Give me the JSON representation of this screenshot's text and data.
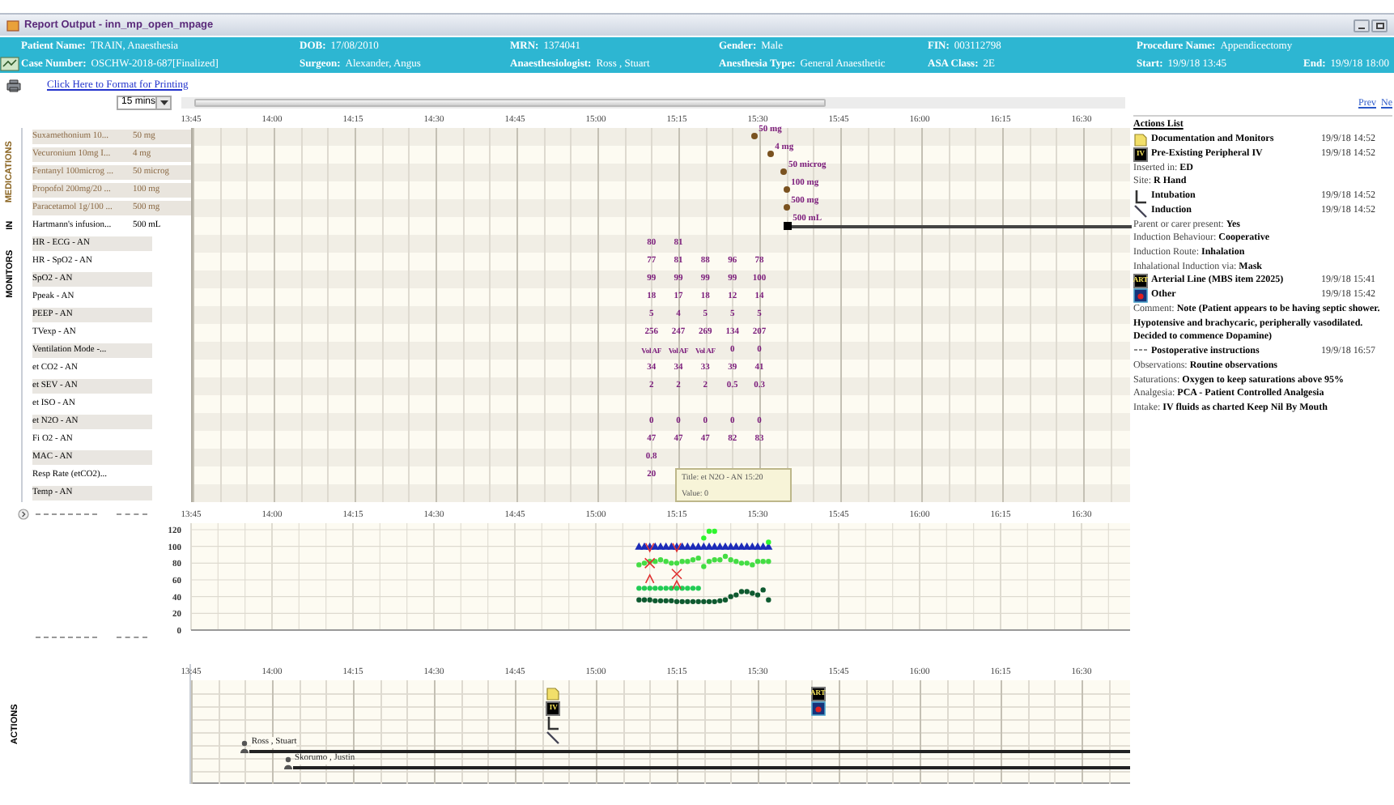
{
  "window": {
    "title": "Report Output - inn_mp_open_mpage"
  },
  "header": {
    "rows": [
      [
        {
          "label": "Patient Name:",
          "value": "TRAIN, Anaesthesia"
        },
        {
          "label": "DOB:",
          "value": "17/08/2010"
        },
        {
          "label": "MRN:",
          "value": "1374041"
        },
        {
          "label": "Gender:",
          "value": "Male"
        },
        {
          "label": "FIN:",
          "value": "003112798"
        },
        {
          "label": "Procedure Name:",
          "value": "Appendicectomy"
        }
      ],
      [
        {
          "label": "Case Number:",
          "value": "OSCHW-2018-687[Finalized]"
        },
        {
          "label": "Surgeon:",
          "value": "Alexander, Angus"
        },
        {
          "label": "Anaesthesiologist:",
          "value": "Ross , Stuart"
        },
        {
          "label": "Anesthesia Type:",
          "value": "General Anaesthetic"
        },
        {
          "label": "ASA Class:",
          "value": "2E"
        },
        {
          "label": "Start:",
          "value": "19/9/18 13:45"
        },
        {
          "label": "End:",
          "value": "19/9/18 18:00"
        }
      ]
    ]
  },
  "print_link": "Click Here to Format for Printing",
  "interval": {
    "value": "15 mins"
  },
  "sections": {
    "medications": "MEDICATIONS",
    "in": "IN",
    "monitors": "MONITORS",
    "actions": "ACTIONS"
  },
  "timeline": {
    "ticks": [
      "13:45",
      "14:00",
      "14:15",
      "14:30",
      "14:45",
      "15:00",
      "15:15",
      "15:30",
      "15:45",
      "16:00",
      "16:15",
      "16:30"
    ]
  },
  "medications": [
    {
      "kind": "bolus",
      "name": "Suxamethonium 10...",
      "dose": "50 mg",
      "chart_dose": "50 mg"
    },
    {
      "kind": "bolus",
      "name": "Vecuronium 10mg I...",
      "dose": "4 mg",
      "chart_dose": "4 mg"
    },
    {
      "kind": "bolus",
      "name": "Fentanyl 100microg ...",
      "dose": "50 microg",
      "chart_dose": "50 microg"
    },
    {
      "kind": "bolus",
      "name": "Propofol 200mg/20 ...",
      "dose": "100 mg",
      "chart_dose": "100 mg"
    },
    {
      "kind": "bolus",
      "name": "Paracetamol 1g/100 ...",
      "dose": "500 mg",
      "chart_dose": "500 mg"
    },
    {
      "kind": "infusion",
      "name": "Hartmann's infusion...",
      "dose": "500 mL",
      "chart_dose": "500 mL"
    }
  ],
  "monitors": [
    {
      "name": "HR - ECG - AN",
      "values": [
        "80",
        "81"
      ]
    },
    {
      "name": "HR - SpO2 - AN",
      "values": [
        "77",
        "81",
        "88",
        "96",
        "78"
      ]
    },
    {
      "name": "SpO2 - AN",
      "values": [
        "99",
        "99",
        "99",
        "99",
        "100"
      ]
    },
    {
      "name": "Ppeak - AN",
      "values": [
        "18",
        "17",
        "18",
        "12",
        "14"
      ]
    },
    {
      "name": "PEEP - AN",
      "values": [
        "5",
        "4",
        "5",
        "5",
        "5"
      ]
    },
    {
      "name": "TVexp - AN",
      "values": [
        "256",
        "247",
        "269",
        "134",
        "207"
      ]
    },
    {
      "name": "Ventilation Mode -...",
      "values": [
        "Vol AF",
        "Vol AF",
        "Vol AF",
        "0",
        "0"
      ]
    },
    {
      "name": "et CO2 - AN",
      "values": [
        "34",
        "34",
        "33",
        "39",
        "41"
      ]
    },
    {
      "name": "et SEV - AN",
      "values": [
        "2",
        "2",
        "2",
        "0.5",
        "0.3"
      ]
    },
    {
      "name": "et ISO - AN"
    },
    {
      "name": "et N2O - AN",
      "values": [
        "0",
        "0",
        "0",
        "0",
        "0"
      ]
    },
    {
      "name": "Fi O2 - AN",
      "values": [
        "47",
        "47",
        "47",
        "82",
        "83"
      ]
    },
    {
      "name": "MAC - AN",
      "values": [
        "0.8"
      ]
    },
    {
      "name": "Resp Rate (etCO2)...",
      "values": [
        "20"
      ]
    },
    {
      "name": "Temp - AN"
    }
  ],
  "tooltip": {
    "title": "Title: et N2O - AN 15:20",
    "value": "Value: 0"
  },
  "vitals": {
    "chart_data": {
      "type": "scatter",
      "categories": [
        "13:45",
        null,
        null,
        null,
        null,
        null,
        null,
        null,
        null,
        null,
        null,
        null,
        null,
        null,
        null,
        "14:00",
        null,
        null,
        null,
        null,
        null,
        null,
        null,
        null,
        null,
        null,
        null,
        null,
        null,
        null,
        "14:15",
        null,
        null,
        null,
        null,
        null,
        null,
        null,
        null,
        null,
        null,
        null,
        null,
        null,
        null,
        "14:30",
        null,
        null,
        null,
        null,
        null,
        null,
        null,
        null,
        null,
        null,
        null,
        null,
        null,
        null,
        "14:45",
        null,
        null,
        null,
        null,
        null,
        null,
        null,
        null,
        null,
        null,
        null,
        null,
        null,
        null,
        "15:00",
        null,
        null,
        null,
        null,
        null,
        null,
        null,
        null,
        null,
        null,
        null,
        null,
        null,
        null,
        "15:15",
        null,
        null,
        null,
        null,
        null,
        null,
        null,
        null,
        null,
        null,
        null,
        null,
        null,
        null,
        "15:30",
        null,
        null,
        null,
        null,
        null,
        null,
        null,
        null,
        null,
        null,
        null,
        null,
        null,
        null,
        "15:45",
        null,
        null,
        null,
        null,
        null,
        null,
        null,
        null,
        null,
        null,
        null,
        null,
        null,
        null,
        "16:00",
        null,
        null,
        null,
        null,
        null,
        null,
        null,
        null,
        null,
        null,
        null,
        null,
        null,
        null,
        "16:15",
        null,
        null,
        null,
        null,
        null,
        null,
        null,
        null,
        null,
        null,
        null,
        null,
        null,
        null,
        "16:30",
        null,
        null,
        null,
        null,
        null,
        null,
        null,
        null,
        null
      ],
      "ylim": [
        0,
        120
      ],
      "yticks": [
        0,
        20,
        40,
        60,
        80,
        100,
        120
      ],
      "grid": true,
      "series": [
        {
          "color": "#1c2bb8",
          "values": [
            null,
            null,
            null,
            null,
            null,
            null,
            null,
            null,
            null,
            null,
            null,
            null,
            null,
            null,
            null,
            null,
            null,
            null,
            null,
            null,
            null,
            null,
            null,
            null,
            null,
            null,
            null,
            null,
            null,
            null,
            null,
            null,
            null,
            null,
            null,
            null,
            null,
            null,
            null,
            null,
            null,
            null,
            null,
            null,
            null,
            null,
            null,
            null,
            null,
            null,
            null,
            null,
            null,
            null,
            null,
            null,
            null,
            null,
            null,
            null,
            null,
            null,
            null,
            null,
            null,
            null,
            null,
            null,
            null,
            null,
            null,
            null,
            null,
            null,
            null,
            null,
            null,
            null,
            null,
            null,
            null,
            null,
            null,
            100,
            100,
            100,
            100,
            100,
            100,
            100,
            100,
            100,
            100,
            100,
            100,
            100,
            100,
            100,
            100,
            100,
            100,
            100,
            100,
            100,
            100,
            100,
            100,
            100,
            null,
            null,
            null,
            null,
            null,
            null,
            null,
            null,
            null,
            null,
            null,
            null,
            null,
            null,
            null,
            null,
            null,
            null,
            null,
            null,
            null,
            null,
            null,
            null,
            null,
            null,
            null,
            null,
            null,
            null,
            null,
            null,
            null,
            null,
            null,
            null,
            null,
            null,
            null,
            null,
            null,
            null,
            null,
            null,
            null,
            null,
            null,
            null,
            null,
            null,
            null,
            null,
            null,
            null,
            null,
            null,
            null,
            null,
            null,
            null,
            null,
            null,
            null,
            null,
            null,
            null,
            null
          ]
        },
        {
          "color": "#2ff52f",
          "values": [
            null,
            null,
            null,
            null,
            null,
            null,
            null,
            null,
            null,
            null,
            null,
            null,
            null,
            null,
            null,
            null,
            null,
            null,
            null,
            null,
            null,
            null,
            null,
            null,
            null,
            null,
            null,
            null,
            null,
            null,
            null,
            null,
            null,
            null,
            null,
            null,
            null,
            null,
            null,
            null,
            null,
            null,
            null,
            null,
            null,
            null,
            null,
            null,
            null,
            null,
            null,
            null,
            null,
            null,
            null,
            null,
            null,
            null,
            null,
            null,
            null,
            null,
            null,
            null,
            null,
            null,
            null,
            null,
            null,
            null,
            null,
            null,
            null,
            null,
            null,
            null,
            null,
            null,
            null,
            null,
            null,
            null,
            null,
            null,
            null,
            null,
            null,
            null,
            null,
            null,
            null,
            null,
            null,
            null,
            null,
            110,
            118,
            118,
            null,
            null,
            null,
            null,
            null,
            null,
            null,
            null,
            null,
            105,
            null,
            null,
            null,
            null,
            null,
            null,
            null,
            null,
            null,
            null,
            null,
            null,
            null,
            null,
            null,
            null,
            null,
            null,
            null,
            null,
            null,
            null,
            null,
            null,
            null,
            null,
            null,
            null,
            null,
            null,
            null,
            null,
            null,
            null,
            null,
            null,
            null,
            null,
            null,
            null,
            null,
            null,
            null,
            null,
            null,
            null,
            null,
            null,
            null,
            null,
            null,
            null,
            null,
            null,
            null,
            null,
            null,
            null,
            null,
            null,
            null,
            null,
            null,
            null,
            null,
            null,
            null
          ]
        },
        {
          "color": "#44dd44",
          "values": [
            null,
            null,
            null,
            null,
            null,
            null,
            null,
            null,
            null,
            null,
            null,
            null,
            null,
            null,
            null,
            null,
            null,
            null,
            null,
            null,
            null,
            null,
            null,
            null,
            null,
            null,
            null,
            null,
            null,
            null,
            null,
            null,
            null,
            null,
            null,
            null,
            null,
            null,
            null,
            null,
            null,
            null,
            null,
            null,
            null,
            null,
            null,
            null,
            null,
            null,
            null,
            null,
            null,
            null,
            null,
            null,
            null,
            null,
            null,
            null,
            null,
            null,
            null,
            null,
            null,
            null,
            null,
            null,
            null,
            null,
            null,
            null,
            null,
            null,
            null,
            null,
            null,
            null,
            null,
            null,
            null,
            null,
            null,
            78,
            80,
            82,
            82,
            84,
            82,
            80,
            80,
            82,
            82,
            84,
            86,
            76,
            82,
            84,
            84,
            88,
            84,
            82,
            80,
            80,
            78,
            82,
            82,
            82,
            null,
            null,
            null,
            null,
            null,
            null,
            null,
            null,
            null,
            null,
            null,
            null,
            null,
            null,
            null,
            null,
            null,
            null,
            null,
            null,
            null,
            null,
            null,
            null,
            null,
            null,
            null,
            null,
            null,
            null,
            null,
            null,
            null,
            null,
            null,
            null,
            null,
            null,
            null,
            null,
            null,
            null,
            null,
            null,
            null,
            null,
            null,
            null,
            null,
            null,
            null,
            null,
            null,
            null,
            null,
            null,
            null,
            null,
            null,
            null,
            null,
            null,
            null,
            null,
            null,
            null,
            null
          ]
        },
        {
          "color": "#22cc55",
          "values": [
            null,
            null,
            null,
            null,
            null,
            null,
            null,
            null,
            null,
            null,
            null,
            null,
            null,
            null,
            null,
            null,
            null,
            null,
            null,
            null,
            null,
            null,
            null,
            null,
            null,
            null,
            null,
            null,
            null,
            null,
            null,
            null,
            null,
            null,
            null,
            null,
            null,
            null,
            null,
            null,
            null,
            null,
            null,
            null,
            null,
            null,
            null,
            null,
            null,
            null,
            null,
            null,
            null,
            null,
            null,
            null,
            null,
            null,
            null,
            null,
            null,
            null,
            null,
            null,
            null,
            null,
            null,
            null,
            null,
            null,
            null,
            null,
            null,
            null,
            null,
            null,
            null,
            null,
            null,
            null,
            null,
            null,
            null,
            50,
            50,
            50,
            50,
            50,
            50,
            50,
            50,
            50,
            50,
            50,
            50,
            null,
            null,
            null,
            null,
            null,
            null,
            null,
            null,
            null,
            null,
            null,
            null,
            null,
            null,
            null,
            null,
            null,
            null,
            null,
            null,
            null,
            null,
            null,
            null,
            null,
            null,
            null,
            null,
            null,
            null,
            null,
            null,
            null,
            null,
            null,
            null,
            null,
            null,
            null,
            null,
            null,
            null,
            null,
            null,
            null,
            null,
            null,
            null,
            null,
            null,
            null,
            null,
            null,
            null,
            null,
            null,
            null,
            null,
            null,
            null,
            null,
            null,
            null,
            null,
            null,
            null,
            null,
            null,
            null,
            null,
            null,
            null,
            null,
            null,
            null,
            null,
            null,
            null,
            null,
            null
          ]
        },
        {
          "color": "#0f5a30",
          "values": [
            null,
            null,
            null,
            null,
            null,
            null,
            null,
            null,
            null,
            null,
            null,
            null,
            null,
            null,
            null,
            null,
            null,
            null,
            null,
            null,
            null,
            null,
            null,
            null,
            null,
            null,
            null,
            null,
            null,
            null,
            null,
            null,
            null,
            null,
            null,
            null,
            null,
            null,
            null,
            null,
            null,
            null,
            null,
            null,
            null,
            null,
            null,
            null,
            null,
            null,
            null,
            null,
            null,
            null,
            null,
            null,
            null,
            null,
            null,
            null,
            null,
            null,
            null,
            null,
            null,
            null,
            null,
            null,
            null,
            null,
            null,
            null,
            null,
            null,
            null,
            null,
            null,
            null,
            null,
            null,
            null,
            null,
            null,
            36,
            36,
            36,
            35,
            35,
            35,
            35,
            34,
            34,
            34,
            34,
            34,
            34,
            34,
            34,
            35,
            36,
            40,
            42,
            46,
            46,
            44,
            42,
            48,
            36,
            null,
            null,
            null,
            null,
            null,
            null,
            null,
            null,
            null,
            null,
            null,
            null,
            null,
            null,
            null,
            null,
            null,
            null,
            null,
            null,
            null,
            null,
            null,
            null,
            null,
            null,
            null,
            null,
            null,
            null,
            null,
            null,
            null,
            null,
            null,
            null,
            null,
            null,
            null,
            null,
            null,
            null,
            null,
            null,
            null,
            null,
            null,
            null,
            null,
            null,
            null,
            null,
            null,
            null,
            null,
            null,
            null,
            null,
            null,
            null,
            null,
            null,
            null,
            null,
            null,
            null,
            null
          ]
        },
        {
          "color": "#e03030",
          "values": [
            null,
            null,
            null,
            null,
            null,
            null,
            null,
            null,
            null,
            null,
            null,
            null,
            null,
            null,
            null,
            null,
            null,
            null,
            null,
            null,
            null,
            null,
            null,
            null,
            null,
            null,
            null,
            null,
            null,
            null,
            null,
            null,
            null,
            null,
            null,
            null,
            null,
            null,
            null,
            null,
            null,
            null,
            null,
            null,
            null,
            null,
            null,
            null,
            null,
            null,
            null,
            null,
            null,
            null,
            null,
            null,
            null,
            null,
            null,
            null,
            null,
            null,
            null,
            null,
            null,
            null,
            null,
            null,
            null,
            null,
            null,
            null,
            null,
            null,
            null,
            null,
            null,
            null,
            null,
            null,
            null,
            null,
            null,
            null,
            null,
            98,
            null,
            null,
            null,
            null,
            98,
            null,
            null,
            null,
            null,
            null,
            null,
            null,
            null,
            null,
            null,
            null,
            null,
            null,
            null,
            null,
            null,
            null,
            null,
            null,
            null,
            null,
            null,
            null,
            null,
            null,
            null,
            null,
            null,
            null,
            null,
            null,
            null,
            null,
            null,
            null,
            null,
            null,
            null,
            null,
            null,
            null,
            null,
            null,
            null,
            null,
            null,
            null,
            null,
            null,
            null,
            null,
            null,
            null,
            null,
            null,
            null,
            null,
            null,
            null,
            null,
            null,
            null,
            null,
            null,
            null,
            null,
            null,
            null,
            null,
            null,
            null,
            null,
            null,
            null,
            null,
            null,
            null,
            null,
            null,
            null,
            null,
            null,
            null,
            null
          ]
        },
        {
          "color": "#e03030",
          "values": [
            null,
            null,
            null,
            null,
            null,
            null,
            null,
            null,
            null,
            null,
            null,
            null,
            null,
            null,
            null,
            null,
            null,
            null,
            null,
            null,
            null,
            null,
            null,
            null,
            null,
            null,
            null,
            null,
            null,
            null,
            null,
            null,
            null,
            null,
            null,
            null,
            null,
            null,
            null,
            null,
            null,
            null,
            null,
            null,
            null,
            null,
            null,
            null,
            null,
            null,
            null,
            null,
            null,
            null,
            null,
            null,
            null,
            null,
            null,
            null,
            null,
            null,
            null,
            null,
            null,
            null,
            null,
            null,
            null,
            null,
            null,
            null,
            null,
            null,
            null,
            null,
            null,
            null,
            null,
            null,
            null,
            null,
            null,
            null,
            null,
            80,
            null,
            null,
            null,
            null,
            67,
            null,
            null,
            null,
            null,
            null,
            null,
            null,
            null,
            null,
            null,
            null,
            null,
            null,
            null,
            null,
            null,
            null,
            null,
            null,
            null,
            null,
            null,
            null,
            null,
            null,
            null,
            null,
            null,
            null,
            null,
            null,
            null,
            null,
            null,
            null,
            null,
            null,
            null,
            null,
            null,
            null,
            null,
            null,
            null,
            null,
            null,
            null,
            null,
            null,
            null,
            null,
            null,
            null,
            null,
            null,
            null,
            null,
            null,
            null,
            null,
            null,
            null,
            null,
            null,
            null,
            null,
            null,
            null,
            null,
            null,
            null,
            null,
            null,
            null,
            null,
            null,
            null,
            null,
            null,
            null,
            null,
            null,
            null,
            null
          ]
        },
        {
          "color": "#e03030",
          "values": [
            null,
            null,
            null,
            null,
            null,
            null,
            null,
            null,
            null,
            null,
            null,
            null,
            null,
            null,
            null,
            null,
            null,
            null,
            null,
            null,
            null,
            null,
            null,
            null,
            null,
            null,
            null,
            null,
            null,
            null,
            null,
            null,
            null,
            null,
            null,
            null,
            null,
            null,
            null,
            null,
            null,
            null,
            null,
            null,
            null,
            null,
            null,
            null,
            null,
            null,
            null,
            null,
            null,
            null,
            null,
            null,
            null,
            null,
            null,
            null,
            null,
            null,
            null,
            null,
            null,
            null,
            null,
            null,
            null,
            null,
            null,
            null,
            null,
            null,
            null,
            null,
            null,
            null,
            null,
            null,
            null,
            null,
            null,
            null,
            null,
            62,
            null,
            null,
            null,
            null,
            55,
            null,
            null,
            null,
            null,
            null,
            null,
            null,
            null,
            null,
            null,
            null,
            null,
            null,
            null,
            null,
            null,
            null,
            null,
            null,
            null,
            null,
            null,
            null,
            null,
            null,
            null,
            null,
            null,
            null,
            null,
            null,
            null,
            null,
            null,
            null,
            null,
            null,
            null,
            null,
            null,
            null,
            null,
            null,
            null,
            null,
            null,
            null,
            null,
            null,
            null,
            null,
            null,
            null,
            null,
            null,
            null,
            null,
            null,
            null,
            null,
            null,
            null,
            null,
            null,
            null,
            null,
            null,
            null,
            null,
            null,
            null,
            null,
            null,
            null,
            null,
            null,
            null,
            null,
            null,
            null,
            null,
            null,
            null,
            null
          ]
        }
      ]
    }
  },
  "actions_lane": {
    "ticks": [
      "13:45",
      "14:00",
      "14:15",
      "14:30",
      "14:45",
      "15:00",
      "15:15",
      "15:30",
      "15:45",
      "16:00",
      "16:15",
      "16:30"
    ],
    "events": [
      {
        "kind": "documentation"
      },
      {
        "kind": "iv",
        "badge": "IV"
      },
      {
        "kind": "intubation"
      },
      {
        "kind": "induction"
      },
      {
        "kind": "arterial",
        "badge": "ART"
      },
      {
        "kind": "other"
      }
    ],
    "staff": [
      "Ross , Stuart",
      "Skorumo , Justin"
    ]
  },
  "pager": {
    "prev": "Prev",
    "next": "Ne"
  },
  "actions_list": {
    "title": "Actions List",
    "items": [
      {
        "kind": "documentation",
        "title": "Documentation and Monitors",
        "time": "19/9/18 14:52"
      },
      {
        "kind": "iv",
        "badge": "IV",
        "title": "Pre-Existing Peripheral IV",
        "time": "19/9/18 14:52"
      },
      {
        "kind": "detail",
        "label": "Inserted in:",
        "value": "ED"
      },
      {
        "kind": "detail",
        "label": "Site:",
        "value": "R Hand"
      },
      {
        "kind": "intubation",
        "title": "Intubation",
        "time": "19/9/18 14:52"
      },
      {
        "kind": "induction",
        "title": "Induction",
        "time": "19/9/18 14:52"
      },
      {
        "kind": "detail",
        "label": "Parent or carer present:",
        "value": "Yes"
      },
      {
        "kind": "detail",
        "label": "Induction Behaviour:",
        "value": "Cooperative"
      },
      {
        "kind": "detail",
        "label": "Induction Route:",
        "value": "Inhalation"
      },
      {
        "kind": "detail",
        "label": "Inhalational Induction via:",
        "value": "Mask"
      },
      {
        "kind": "arterial",
        "badge": "ART",
        "title": "Arterial Line (MBS item 22025)",
        "time": "19/9/18 15:41"
      },
      {
        "kind": "other",
        "title": "Other",
        "time": "19/9/18 15:42"
      },
      {
        "kind": "detail",
        "label": "Comment:",
        "value": "Note (Patient appears to be having septic shower. Hypotensive and brachycaric, peripherally vasodilated. Decided to commence Dopamine)"
      },
      {
        "kind": "postop",
        "title": "Postoperative instructions",
        "time": "19/9/18 16:57"
      },
      {
        "kind": "detail",
        "label": "Observations:",
        "value": "Routine observations"
      },
      {
        "kind": "detail",
        "label": "Saturations:",
        "value": "Oxygen to keep saturations above 95%"
      },
      {
        "kind": "detail",
        "label": "Analgesia:",
        "value": "PCA - Patient Controlled Analgesia"
      },
      {
        "kind": "detail",
        "label": "Intake:",
        "value": "IV fluids as charted  Keep Nil By Mouth"
      }
    ]
  }
}
